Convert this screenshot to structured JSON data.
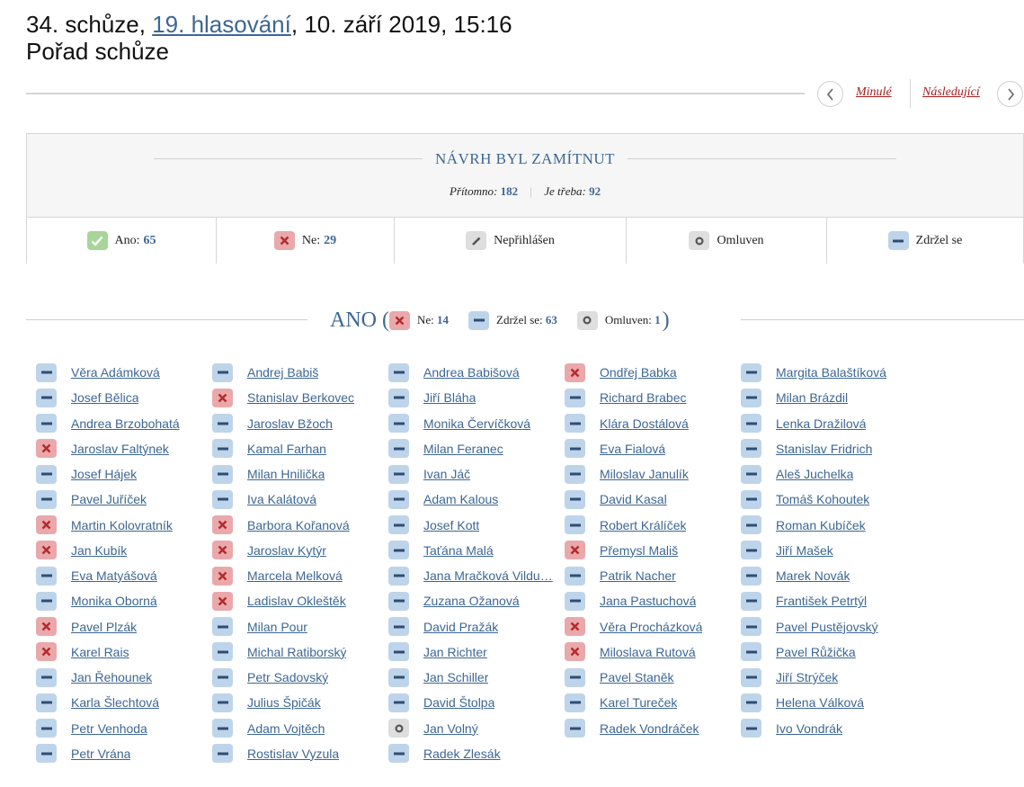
{
  "header": {
    "prefix": "34. schůze, ",
    "vote_link": "19. hlasování",
    "suffix": ", 10. září 2019, 15:16",
    "subtitle": "Pořad schůze"
  },
  "nav": {
    "prev_label": "Minulé",
    "next_label": "Následující",
    "prev_icon": "chevron-left-icon",
    "next_icon": "chevron-right-icon"
  },
  "result": {
    "title": "NÁVRH BYL ZAMÍTNUT",
    "present_label": "Přítomno:",
    "present_value": "182",
    "required_label": "Je třeba:",
    "required_value": "92"
  },
  "legend": {
    "yes_label": "Ano:",
    "yes_value": "65",
    "no_label": "Ne:",
    "no_value": "29",
    "notreg_label": "Nepřihlášen",
    "excused_label": "Omluven",
    "abstain_label": "Zdržel se"
  },
  "section": {
    "title": "ANO (",
    "close": ")",
    "no_label": "Ne:",
    "no_value": "14",
    "abstain_label": "Zdržel se:",
    "abstain_value": "63",
    "excused_label": "Omluven:",
    "excused_value": "1"
  },
  "colors": {
    "yes": "#a8d69a",
    "no": "#e9a9ab",
    "abstain": "#bed4ea",
    "excused": "#dedede",
    "link": "#3d6794",
    "nav_link": "#a01c1c"
  },
  "members": [
    [
      {
        "n": "Věra Adámková",
        "v": "abs"
      },
      {
        "n": "Josef Bělica",
        "v": "abs"
      },
      {
        "n": "Andrea Brzobohatá",
        "v": "abs"
      },
      {
        "n": "Jaroslav Faltýnek",
        "v": "no"
      },
      {
        "n": "Josef Hájek",
        "v": "abs"
      },
      {
        "n": "Pavel Juříček",
        "v": "abs"
      },
      {
        "n": "Martin Kolovratník",
        "v": "no"
      },
      {
        "n": "Jan Kubík",
        "v": "no"
      },
      {
        "n": "Eva Matyášová",
        "v": "abs"
      },
      {
        "n": "Monika Oborná",
        "v": "abs"
      },
      {
        "n": "Pavel Plzák",
        "v": "no"
      },
      {
        "n": "Karel Rais",
        "v": "no"
      },
      {
        "n": "Jan Řehounek",
        "v": "abs"
      },
      {
        "n": "Karla Šlechtová",
        "v": "abs"
      },
      {
        "n": "Petr Venhoda",
        "v": "abs"
      },
      {
        "n": "Petr Vrána",
        "v": "abs"
      }
    ],
    [
      {
        "n": "Andrej Babiš",
        "v": "abs"
      },
      {
        "n": "Stanislav Berkovec",
        "v": "no"
      },
      {
        "n": "Jaroslav Bžoch",
        "v": "abs"
      },
      {
        "n": "Kamal Farhan",
        "v": "abs"
      },
      {
        "n": "Milan Hnilička",
        "v": "abs"
      },
      {
        "n": "Iva Kalátová",
        "v": "abs"
      },
      {
        "n": "Barbora Kořanová",
        "v": "no"
      },
      {
        "n": "Jaroslav Kytýr",
        "v": "no"
      },
      {
        "n": "Marcela Melková",
        "v": "no"
      },
      {
        "n": "Ladislav Okleštěk",
        "v": "no"
      },
      {
        "n": "Milan Pour",
        "v": "abs"
      },
      {
        "n": "Michal Ratiborský",
        "v": "abs"
      },
      {
        "n": "Petr Sadovský",
        "v": "abs"
      },
      {
        "n": "Julius Špičák",
        "v": "abs"
      },
      {
        "n": "Adam Vojtěch",
        "v": "abs"
      },
      {
        "n": "Rostislav Vyzula",
        "v": "abs"
      }
    ],
    [
      {
        "n": "Andrea Babišová",
        "v": "abs"
      },
      {
        "n": "Jiří Bláha",
        "v": "abs"
      },
      {
        "n": "Monika Červíčková",
        "v": "abs"
      },
      {
        "n": "Milan Feranec",
        "v": "abs"
      },
      {
        "n": "Ivan Jáč",
        "v": "abs"
      },
      {
        "n": "Adam Kalous",
        "v": "abs"
      },
      {
        "n": "Josef Kott",
        "v": "abs"
      },
      {
        "n": "Taťána Malá",
        "v": "abs"
      },
      {
        "n": "Jana Mračková Vildu…",
        "v": "abs"
      },
      {
        "n": "Zuzana Ožanová",
        "v": "abs"
      },
      {
        "n": "David Pražák",
        "v": "abs"
      },
      {
        "n": "Jan Richter",
        "v": "abs"
      },
      {
        "n": "Jan Schiller",
        "v": "abs"
      },
      {
        "n": "David Štolpa",
        "v": "abs"
      },
      {
        "n": "Jan Volný",
        "v": "exc"
      },
      {
        "n": "Radek Zlesák",
        "v": "abs"
      }
    ],
    [
      {
        "n": "Ondřej Babka",
        "v": "no"
      },
      {
        "n": "Richard Brabec",
        "v": "abs"
      },
      {
        "n": "Klára Dostálová",
        "v": "abs"
      },
      {
        "n": "Eva Fialová",
        "v": "abs"
      },
      {
        "n": "Miloslav Janulík",
        "v": "abs"
      },
      {
        "n": "David Kasal",
        "v": "abs"
      },
      {
        "n": "Robert Králíček",
        "v": "abs"
      },
      {
        "n": "Přemysl Mališ",
        "v": "no"
      },
      {
        "n": "Patrik Nacher",
        "v": "abs"
      },
      {
        "n": "Jana Pastuchová",
        "v": "abs"
      },
      {
        "n": "Věra Procházková",
        "v": "no"
      },
      {
        "n": "Miloslava Rutová",
        "v": "no"
      },
      {
        "n": "Pavel Staněk",
        "v": "abs"
      },
      {
        "n": "Karel Tureček",
        "v": "abs"
      },
      {
        "n": "Radek Vondráček",
        "v": "abs"
      }
    ],
    [
      {
        "n": "Margita Balaštíková",
        "v": "abs"
      },
      {
        "n": "Milan Brázdil",
        "v": "abs"
      },
      {
        "n": "Lenka Dražilová",
        "v": "abs"
      },
      {
        "n": "Stanislav Fridrich",
        "v": "abs"
      },
      {
        "n": "Aleš Juchelka",
        "v": "abs"
      },
      {
        "n": "Tomáš Kohoutek",
        "v": "abs"
      },
      {
        "n": "Roman Kubíček",
        "v": "abs"
      },
      {
        "n": "Jiří Mašek",
        "v": "abs"
      },
      {
        "n": "Marek Novák",
        "v": "abs"
      },
      {
        "n": "František Petrtýl",
        "v": "abs"
      },
      {
        "n": "Pavel Pustějovský",
        "v": "abs"
      },
      {
        "n": "Pavel Růžička",
        "v": "abs"
      },
      {
        "n": "Jiří Strýček",
        "v": "abs"
      },
      {
        "n": "Helena Válková",
        "v": "abs"
      },
      {
        "n": "Ivo Vondrák",
        "v": "abs"
      }
    ]
  ]
}
